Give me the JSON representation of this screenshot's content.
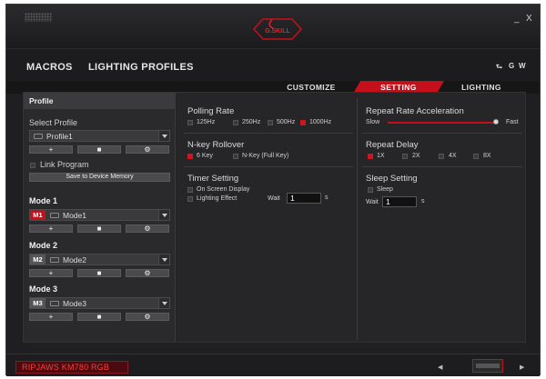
{
  "window": {
    "minimize": "_",
    "close": "X"
  },
  "brand": {
    "logo_text": "G.SKILL"
  },
  "nav": {
    "macros": "MACROS",
    "lighting_profiles": "LIGHTING PROFILES",
    "right": [
      "⮑",
      "G",
      "W"
    ]
  },
  "tabs": [
    "CUSTOMIZE",
    "SETTING",
    "LIGHTING"
  ],
  "left": {
    "profile_header": "Profile",
    "select_profile_label": "Select Profile",
    "profile_value": "Profile1",
    "link_program": "Link Program",
    "save_button": "Save to Device Memory",
    "btn_add": "+",
    "btn_delete": "■",
    "btn_settings": "⚙",
    "modes": [
      {
        "title": "Mode 1",
        "badge": "M1",
        "value": "Mode1"
      },
      {
        "title": "Mode 2",
        "badge": "M2",
        "value": "Mode2"
      },
      {
        "title": "Mode 3",
        "badge": "M3",
        "value": "Mode3"
      }
    ]
  },
  "settings": {
    "polling_rate": {
      "title": "Polling Rate",
      "options": [
        "125Hz",
        "250Hz",
        "500Hz",
        "1000Hz"
      ],
      "selected": "1000Hz"
    },
    "nkey": {
      "title": "N-key Rollover",
      "options": [
        "6 Key",
        "N-Key (Full Key)"
      ],
      "selected": "6 Key"
    },
    "timer": {
      "title": "Timer Setting",
      "on_screen": "On Screen Display",
      "lighting_effect": "Lighting Effect",
      "wait_label": "Wait",
      "wait_value": "1",
      "unit": "s"
    },
    "repeat_accel": {
      "title": "Repeat Rate Acceleration",
      "slow": "Slow",
      "fast": "Fast",
      "level": 1.0
    },
    "repeat_delay": {
      "title": "Repeat Delay",
      "options": [
        "1X",
        "2X",
        "4X",
        "8X"
      ],
      "selected": "1X"
    },
    "sleep": {
      "title": "Sleep Setting",
      "sleep_label": "Sleep",
      "wait_label": "Wait",
      "wait_value": "1",
      "unit": "s"
    }
  },
  "bottom": {
    "device": "RIPJAWS KM780 RGB",
    "prev": "◀",
    "next": "▶"
  },
  "colors": {
    "accent": "#c4101a",
    "background": "#1f1f21"
  }
}
